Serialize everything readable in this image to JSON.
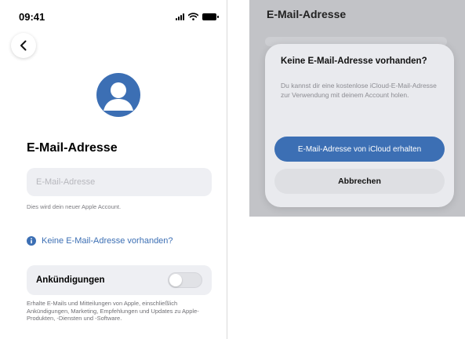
{
  "status_bar": {
    "time": "09:41",
    "icons": [
      "signal-icon",
      "wifi-icon",
      "battery-icon"
    ]
  },
  "signup": {
    "back_icon": "chevron-left-icon",
    "avatar_icon": "person-icon",
    "title": "E-Mail-Adresse",
    "email_field": {
      "value": "",
      "placeholder": "E-Mail-Adresse"
    },
    "hint": "Dies wird dein neuer Apple Account.",
    "no_email_link": {
      "icon": "info-icon",
      "label": "Keine E-Mail-Adresse vorhanden?"
    },
    "announcements": {
      "label": "Ankündigungen",
      "toggle_on": false,
      "description": "Erhalte E-Mails und Mitteilungen von Apple, einschließlich Ankündigungen, Marketing, Empfehlungen und Updates zu Apple-Produkten, -Diensten und -Software."
    }
  },
  "dialog_screen": {
    "background_title": "E-Mail-Adresse",
    "dialog": {
      "title": "Keine E-Mail-Adresse vorhanden?",
      "body": "Du kannst dir eine kostenlose iCloud-E-Mail-Adresse zur Verwendung mit deinem Account holen.",
      "primary_button": "E-Mail-Adresse von iCloud erhalten",
      "cancel_button": "Abbrechen"
    }
  },
  "colors": {
    "accent": "#3c6fb4",
    "field_background": "#eeeff3",
    "dialog_background": "#e9eaee",
    "dimmed_background": "#c2c3c7"
  }
}
